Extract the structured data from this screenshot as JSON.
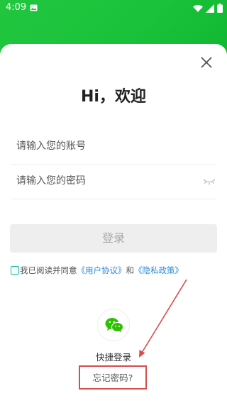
{
  "status_bar": {
    "time": "4:09",
    "icons": [
      "image-icon",
      "wifi-icon",
      "signal-icon",
      "battery-icon"
    ]
  },
  "header": {
    "title": "Hi，欢迎",
    "close_icon": "close-icon"
  },
  "form": {
    "account_placeholder": "请输入您的账号",
    "password_placeholder": "请输入您的密码",
    "password_toggle_icon": "eye-closed-icon",
    "login_label": "登录"
  },
  "agreement": {
    "prefix": "我已阅读并同意",
    "user_agreement": "《用户协议》",
    "and": "和",
    "privacy_policy": "《隐私政策》",
    "checked": false
  },
  "quick_login": {
    "icon": "wechat-icon",
    "label": "快捷登录"
  },
  "forgot": {
    "label": "忘记密码?"
  },
  "colors": {
    "brand_green": "#1bc23c",
    "link_blue": "#2b8ad8",
    "checkbox_teal": "#18c0a0",
    "annotation_red": "#d84c4c",
    "wechat_green": "#2dc100"
  }
}
